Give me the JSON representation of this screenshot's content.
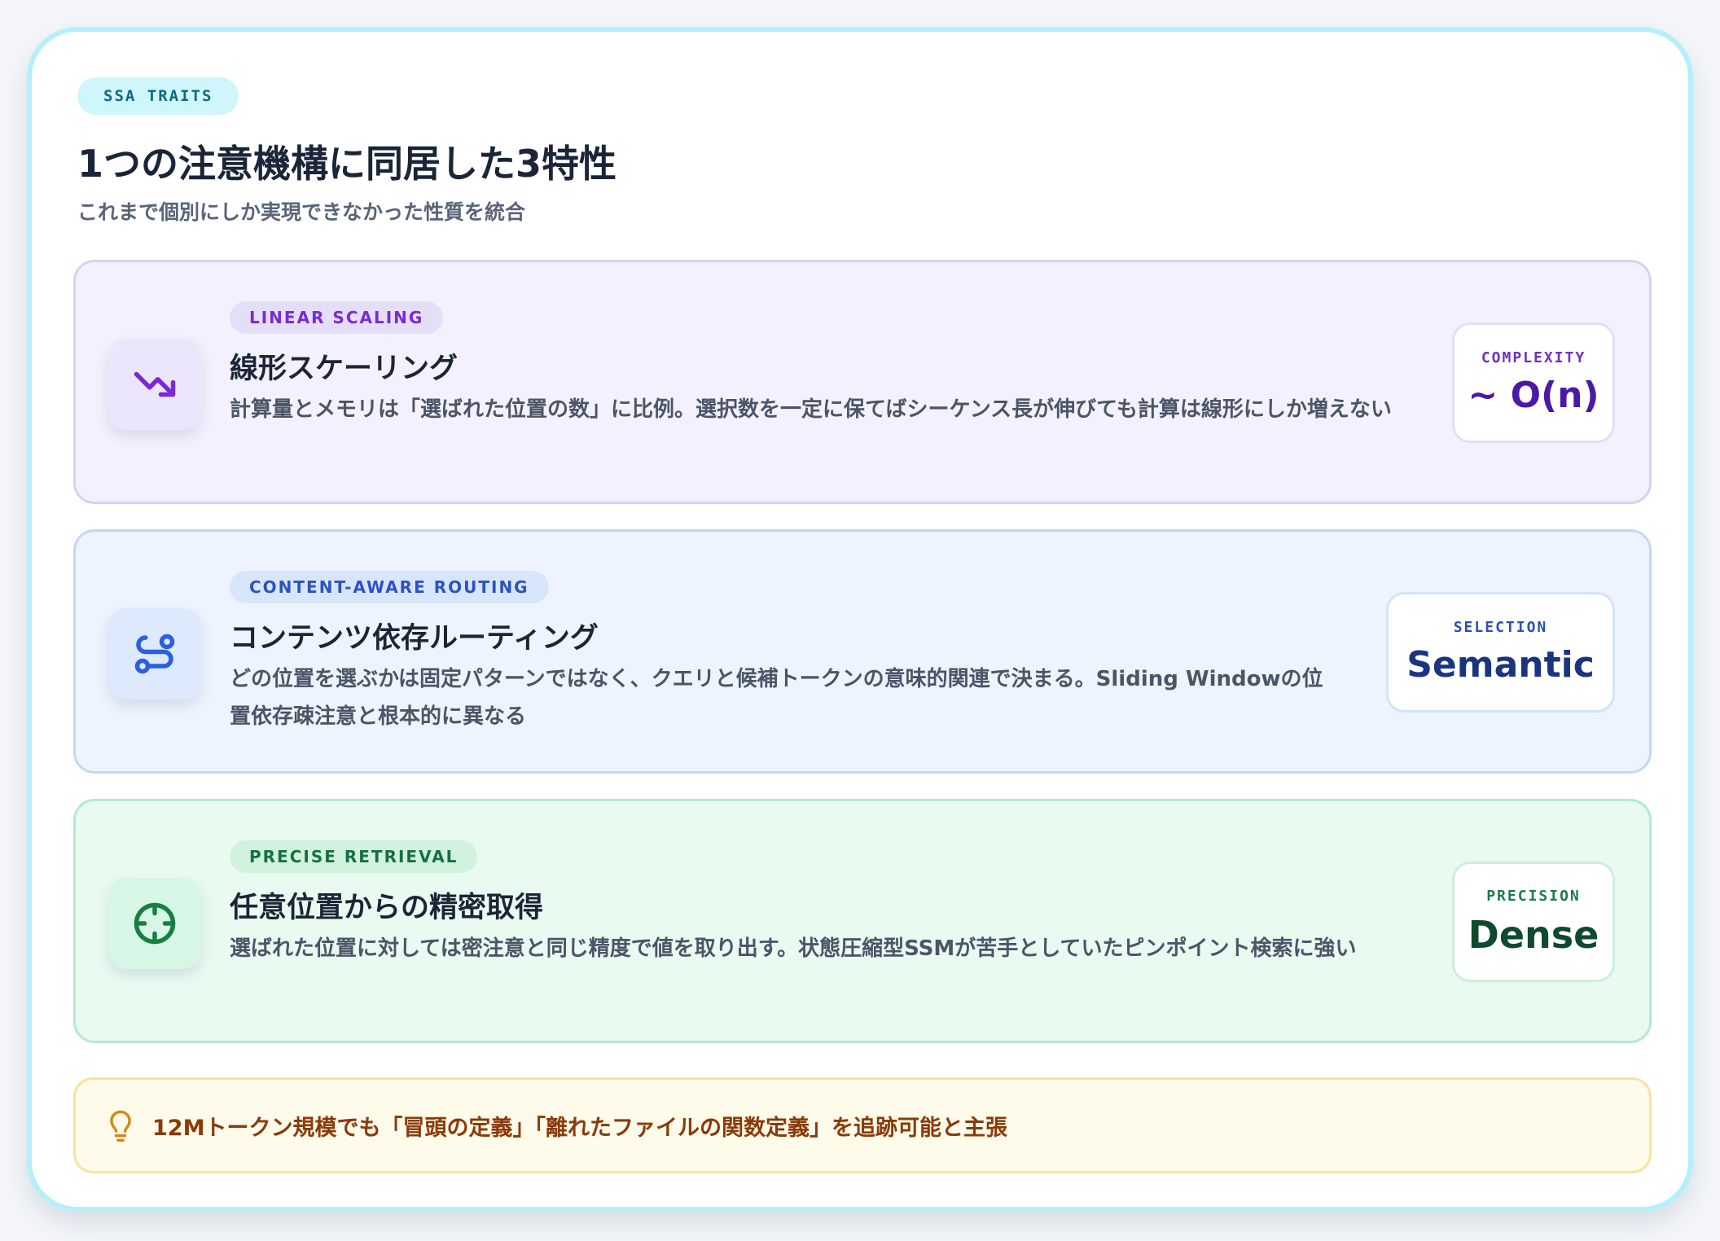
{
  "eyebrow": "SSA TRAITS",
  "title": "1つの注意機構に同居した3特性",
  "subtitle": "これまで個別にしか実現できなかった性質を統合",
  "traits": [
    {
      "tag": "LINEAR SCALING",
      "title": "線形スケーリング",
      "description": "計算量とメモリは「選ばれた位置の数」に比例。選択数を一定に保てばシーケンス長が伸びても計算は線形にしか増えない",
      "metric_label": "COMPLEXITY",
      "metric_value": "~ O(n)",
      "icon": "trending-down-icon",
      "accent": "#7a2ad3"
    },
    {
      "tag": "CONTENT-AWARE ROUTING",
      "title": "コンテンツ依存ルーティング",
      "description": "どの位置を選ぶかは固定パターンではなく、クエリと候補トークンの意味的関連で決まる。Sliding Windowの位置依存疎注意と根本的に異なる",
      "metric_label": "SELECTION",
      "metric_value": "Semantic",
      "icon": "route-icon",
      "accent": "#2c52c6"
    },
    {
      "tag": "PRECISE RETRIEVAL",
      "title": "任意位置からの精密取得",
      "description": "選ばれた位置に対しては密注意と同じ精度で値を取り出す。状態圧縮型SSMが苦手としていたピンポイント検索に強い",
      "metric_label": "PRECISION",
      "metric_value": "Dense",
      "icon": "crosshair-icon",
      "accent": "#17703f"
    }
  ],
  "note": {
    "icon": "lightbulb-icon",
    "text": "12Mトークン規模でも「冒頭の定義」「離れたファイルの関数定義」を追跡可能と主張",
    "accent": "#d08a1a"
  }
}
